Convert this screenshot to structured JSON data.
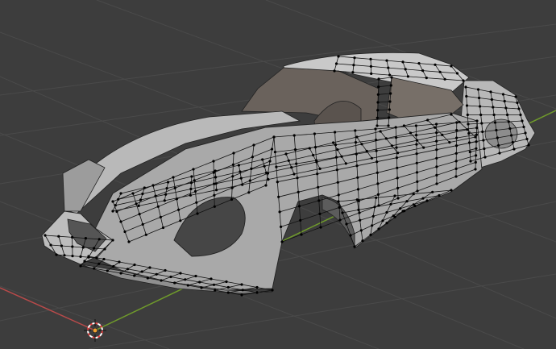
{
  "viewport": {
    "kind": "3d-viewport",
    "mode": "edit-mode",
    "object": "car-body-mesh",
    "colors": {
      "background": "#3d3d3d",
      "grid": "#4a4a4a",
      "x_axis": "#b84a4a",
      "y_axis": "#6f9a2b",
      "mesh_light": "#c4c4c4",
      "mesh_dark": "#8f8f8f",
      "interior": "#6a625c",
      "wire": "#111111",
      "vertex": "#000000",
      "cursor_red": "#e04040",
      "cursor_white": "#ffffff",
      "origin": "#f0a030"
    }
  },
  "cursor": {
    "icon": "3d-cursor-icon"
  },
  "origin": {
    "icon": "object-origin-icon"
  }
}
